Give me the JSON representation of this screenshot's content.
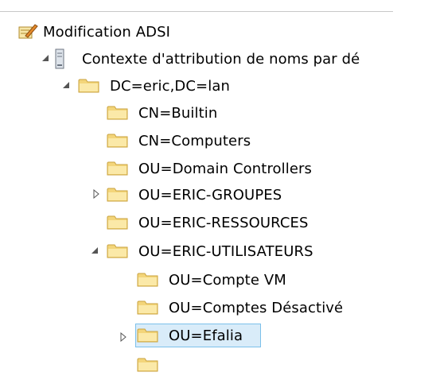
{
  "tree": {
    "root": {
      "label": "Modification ADSI",
      "icon": "adsi-edit-icon"
    },
    "naming_context": {
      "label": "Contexte d'attribution de noms par dé",
      "icon": "server-icon",
      "expanded": true
    },
    "domain": {
      "label": "DC=eric,DC=lan",
      "icon": "folder-icon",
      "expanded": true
    },
    "containers": [
      {
        "label": "CN=Builtin"
      },
      {
        "label": "CN=Computers"
      },
      {
        "label": "OU=Domain Controllers"
      },
      {
        "label": "OU=ERIC-GROUPES",
        "collapsed": true
      },
      {
        "label": "OU=ERIC-RESSOURCES"
      },
      {
        "label": "OU=ERIC-UTILISATEURS",
        "expanded": true
      }
    ],
    "users_children": [
      {
        "label": "OU=Compte VM"
      },
      {
        "label": "OU=Comptes Désactivé"
      },
      {
        "label": "OU=Efalia",
        "collapsed": true,
        "selected": true
      }
    ]
  },
  "colors": {
    "selection_fill": "#d9ecf9",
    "selection_border": "#7cc0ea",
    "folder": "#f3d57a"
  }
}
